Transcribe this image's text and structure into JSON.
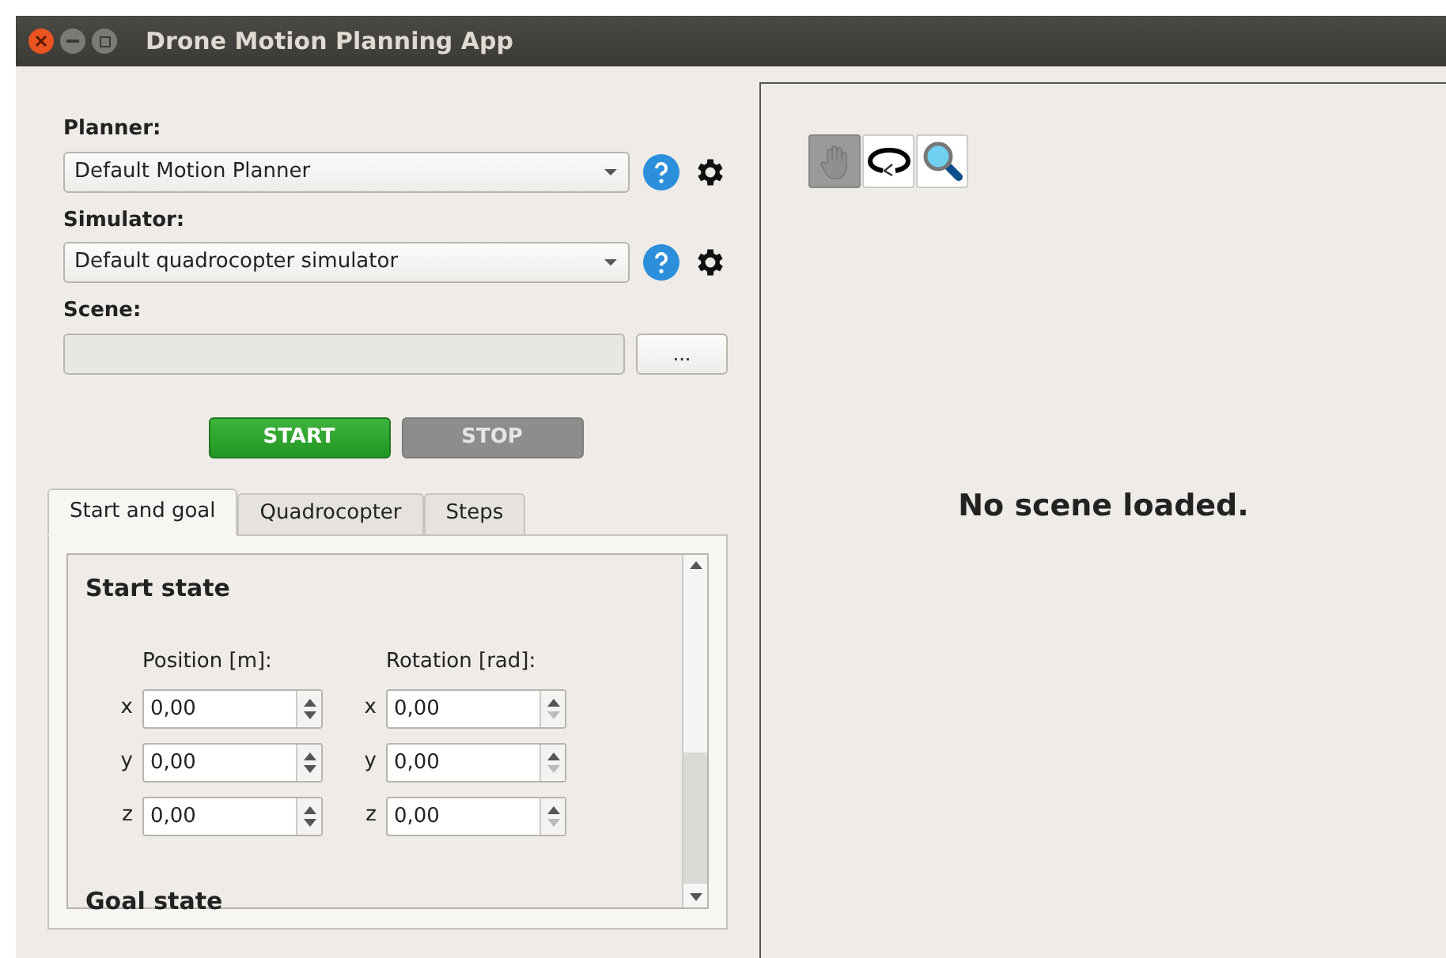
{
  "window": {
    "title": "Drone Motion Planning App"
  },
  "planner": {
    "label": "Planner:",
    "value": "Default Motion Planner"
  },
  "simulator": {
    "label": "Simulator:",
    "value": "Default quadrocopter simulator"
  },
  "scene": {
    "label": "Scene:",
    "browse_button": "..."
  },
  "buttons": [
    {
      "label": "START",
      "disabled": false
    },
    {
      "label": "STOP",
      "disabled": true
    }
  ],
  "tabs": [
    {
      "label": "Start and goal",
      "selected": true
    },
    {
      "label": "Quadrocopter",
      "selected": false
    },
    {
      "label": "Steps",
      "selected": false
    }
  ],
  "start_state": {
    "title": "Start state",
    "columns": [
      {
        "label": "Position [m]:",
        "fields": [
          {
            "axis": "x",
            "value": "0,00",
            "down_disabled": false
          },
          {
            "axis": "y",
            "value": "0,00",
            "down_disabled": false
          },
          {
            "axis": "z",
            "value": "0,00",
            "down_disabled": false
          }
        ]
      },
      {
        "label": "Rotation [rad]:",
        "fields": [
          {
            "axis": "x",
            "value": "0,00",
            "down_disabled": true
          },
          {
            "axis": "y",
            "value": "0,00",
            "down_disabled": true
          },
          {
            "axis": "z",
            "value": "0,00",
            "down_disabled": true
          }
        ]
      }
    ]
  },
  "goal_state": {
    "title": "Goal state"
  },
  "view_tools": [
    {
      "kind": "pan",
      "selected": true
    },
    {
      "kind": "rotate",
      "selected": false
    },
    {
      "kind": "zoom",
      "selected": false
    }
  ],
  "viewport": {
    "message": "No scene loaded."
  }
}
